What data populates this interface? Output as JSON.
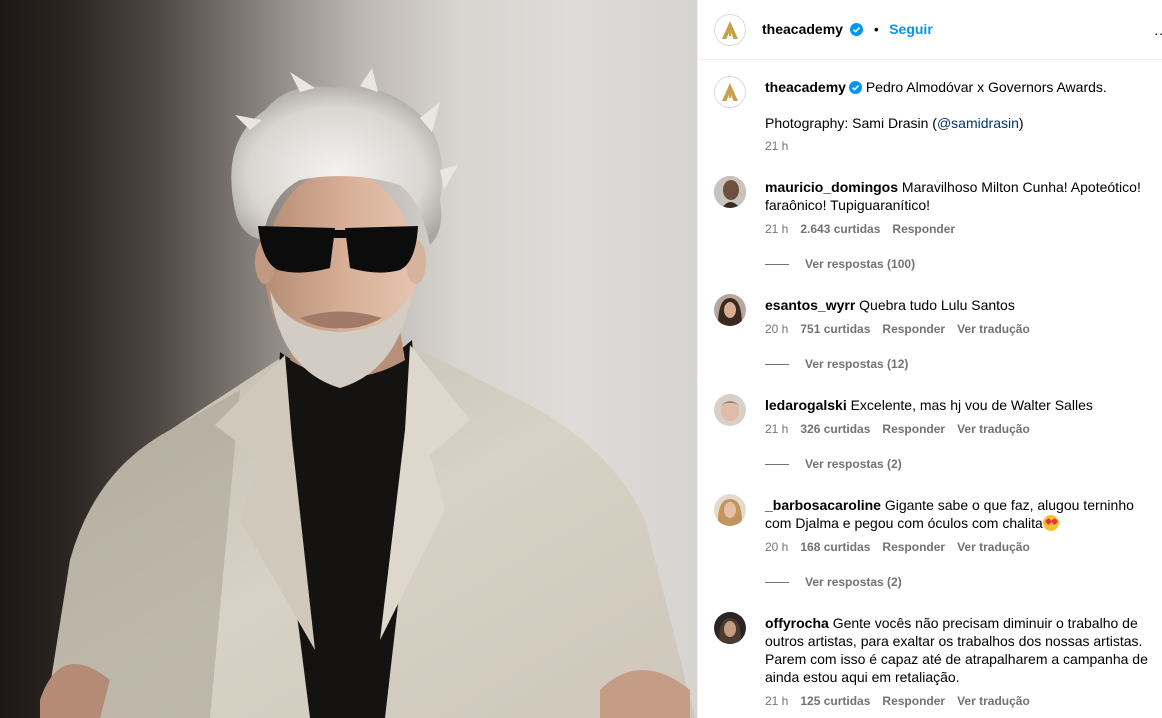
{
  "post": {
    "account": "theacademy",
    "follow_label": "Seguir",
    "dot": "•",
    "more": "...",
    "caption_line1": "Pedro Almodóvar x Governors Awards.",
    "caption_prefix": "Photography: Sami Drasin (",
    "caption_mention": "@samidrasin",
    "caption_suffix": ")",
    "time": "21 h"
  },
  "comments": [
    {
      "user": "mauricio_domingos",
      "text": "Maravilhoso Milton Cunha! Apoteótico! faraônico! Tupiguaranítico!",
      "time": "21 h",
      "likes": "2.643 curtidas",
      "reply": "Responder",
      "translate": "",
      "view_replies": "Ver respostas (100)"
    },
    {
      "user": "esantos_wyrr",
      "text": "Quebra tudo Lulu Santos",
      "time": "20 h",
      "likes": "751 curtidas",
      "reply": "Responder",
      "translate": "Ver tradução",
      "view_replies": "Ver respostas (12)"
    },
    {
      "user": "ledarogalski",
      "text": "Excelente, mas hj vou de Walter Salles",
      "time": "21 h",
      "likes": "326 curtidas",
      "reply": "Responder",
      "translate": "Ver tradução",
      "view_replies": "Ver respostas (2)"
    },
    {
      "user": "_barbosacaroline",
      "text": "Gigante sabe o que faz, alugou terninho com Djalma e pegou com óculos com chalita",
      "time": "20 h",
      "likes": "168 curtidas",
      "reply": "Responder",
      "translate": "Ver tradução",
      "view_replies": "Ver respostas (2)"
    },
    {
      "user": "offyrocha",
      "text": "Gente vocês não precisam diminuir o trabalho de outros artistas, para exaltar os trabalhos dos nossas artistas. Parem com isso é capaz até de atrapalharem a campanha de ainda estou aqui em retaliação.",
      "time": "21 h",
      "likes": "125 curtidas",
      "reply": "Responder",
      "translate": "Ver tradução",
      "view_replies": ""
    }
  ],
  "colors": {
    "follow": "#0095f6",
    "muted": "#737373",
    "verified": "#0095f6"
  },
  "icons": [
    "academy-logo-icon",
    "verified-badge-icon",
    "heart-eyes-emoji-icon"
  ]
}
